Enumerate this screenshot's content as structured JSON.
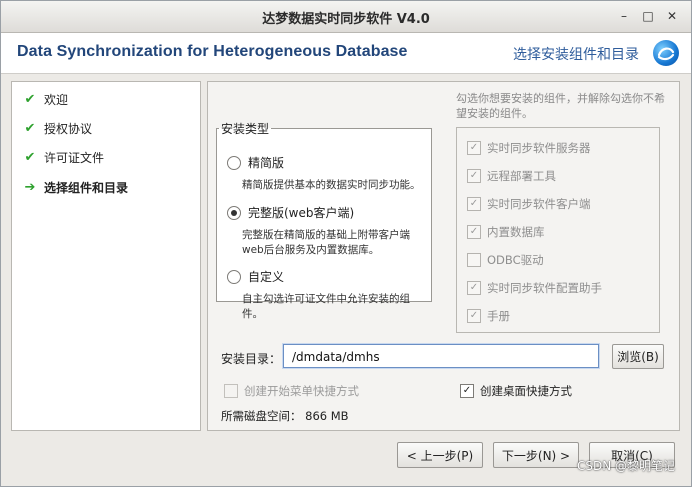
{
  "window": {
    "title": "达梦数据实时同步软件  V4.0",
    "controls": {
      "minimize": "–",
      "maximize": "□",
      "close": "✕"
    }
  },
  "header": {
    "title_en": "Data Synchronization for Heterogeneous Database",
    "title_cn": "选择安装组件和目录",
    "logo_icon": "dm-logo-icon"
  },
  "sidebar": {
    "steps": [
      {
        "label": "欢迎",
        "state": "done"
      },
      {
        "label": "授权协议",
        "state": "done"
      },
      {
        "label": "许可证文件",
        "state": "done"
      },
      {
        "label": "选择组件和目录",
        "state": "current"
      }
    ]
  },
  "main": {
    "hint": "勾选你想要安装的组件，并解除勾选你不希望安装的组件。",
    "install_type": {
      "legend": "安装类型",
      "options": [
        {
          "label": "精简版",
          "desc": "精简版提供基本的数据实时同步功能。",
          "selected": false
        },
        {
          "label": "完整版(web客户端)",
          "desc": "完整版在精简版的基础上附带客户端web后台服务及内置数据库。",
          "selected": true
        },
        {
          "label": "自定义",
          "desc": "自主勾选许可证文件中允许安装的组件。",
          "selected": false
        }
      ]
    },
    "components": [
      {
        "label": "实时同步软件服务器",
        "checked": true
      },
      {
        "label": "远程部署工具",
        "checked": true
      },
      {
        "label": "实时同步软件客户端",
        "checked": true
      },
      {
        "label": "内置数据库",
        "checked": true
      },
      {
        "label": "ODBC驱动",
        "checked": false
      },
      {
        "label": "实时同步软件配置助手",
        "checked": true
      },
      {
        "label": "手册",
        "checked": true
      }
    ],
    "install_dir": {
      "label": "安装目录：",
      "value": "/dmdata/dmhs"
    },
    "browse_label": "浏览(B)",
    "start_menu_shortcut": {
      "label": "创建开始菜单快捷方式",
      "checked": false,
      "enabled": false
    },
    "desktop_shortcut": {
      "label": "创建桌面快捷方式",
      "checked": true,
      "enabled": true
    },
    "disk_space": "所需磁盘空间： 866 MB"
  },
  "footer": {
    "prev_label": "< 上一步(P)",
    "next_label": "下一步(N) >",
    "cancel_label": "取消(C)"
  },
  "watermark": "CSDN @黎明笔记"
}
